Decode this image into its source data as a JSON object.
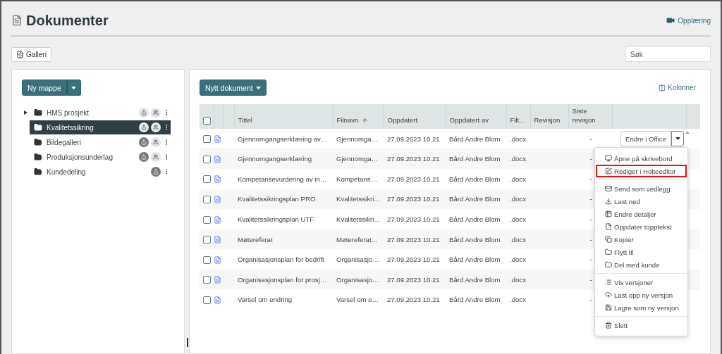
{
  "header": {
    "title": "Dokumenter",
    "training_link": "Opplæring"
  },
  "toolbar": {
    "gallery_button": "Galleri",
    "search": {
      "placeholder": "Søk"
    }
  },
  "folders": {
    "new_button": "Ny mappe",
    "items": [
      {
        "label": "HMS prosjekt",
        "kind": "closed",
        "expandable": true,
        "selected": false,
        "shared": false,
        "people": true
      },
      {
        "label": "Kvalitetssikring",
        "kind": "closed",
        "expandable": false,
        "selected": true,
        "shared": false,
        "people": true
      },
      {
        "label": "Bildegalleri",
        "kind": "open",
        "expandable": false,
        "selected": false,
        "shared": true,
        "people": true
      },
      {
        "label": "Produksjonsunderlag",
        "kind": "open",
        "expandable": false,
        "selected": false,
        "shared": true,
        "people": true
      },
      {
        "label": "Kundedeling",
        "kind": "open",
        "expandable": false,
        "selected": false,
        "shared": true,
        "people": false
      }
    ]
  },
  "documents": {
    "new_button": "Nytt dokument",
    "columns_button": "Kolonner",
    "select_all": {
      "checked": false
    },
    "columns": [
      {
        "label": "Tittel",
        "sorted": false
      },
      {
        "label": "Filnavn",
        "sorted": true
      },
      {
        "label": "Oppdatert",
        "sorted": false
      },
      {
        "label": "Oppdatert av",
        "sorted": false
      },
      {
        "label": "Filt…",
        "sorted": false
      },
      {
        "label": "Revisjon",
        "sorted": false
      },
      {
        "label": "Siste revisjon",
        "sorted": false
      }
    ],
    "rows": [
      {
        "title": "Gjennomgangserklæring av…",
        "filename": "Gjennomga…",
        "updated": "27.09.2023 10.21",
        "updated_by": "Bård Andre Blom",
        "filetype": ".docx",
        "last_revision": "-",
        "action": "Endre i Office",
        "checked": false
      },
      {
        "title": "Gjennomgangserklæring",
        "filename": "Gjennomga…",
        "updated": "27.09.2023 10.21",
        "updated_by": "Bård Andre Blom",
        "filetype": ".docx",
        "last_revision": "-",
        "checked": false
      },
      {
        "title": "Kompetansevurdering av in…",
        "filename": "Kompetans…",
        "updated": "27.09.2023 10.21",
        "updated_by": "Bård Andre Blom",
        "filetype": ".docx",
        "last_revision": "-",
        "checked": false
      },
      {
        "title": "Kvalitetssikringsplan PRO",
        "filename": "Kvalitetssikri…",
        "updated": "27.09.2023 10.21",
        "updated_by": "Bård Andre Blom",
        "filetype": ".docx",
        "last_revision": "-",
        "checked": false
      },
      {
        "title": "Kvalitetssikringsplan UTF",
        "filename": "Kvalitetssikri…",
        "updated": "27.09.2023 10.21",
        "updated_by": "Bård Andre Blom",
        "filetype": ".docx",
        "last_revision": "-",
        "checked": false
      },
      {
        "title": "Møtereferat",
        "filename": "Møtereferat…",
        "updated": "27.09.2023 10.21",
        "updated_by": "Bård Andre Blom",
        "filetype": ".docx",
        "last_revision": "-",
        "checked": false
      },
      {
        "title": "Organisasjonsplan for bedrift",
        "filename": "Organisasjo…",
        "updated": "27.09.2023 10.21",
        "updated_by": "Bård Andre Blom",
        "filetype": ".docx",
        "last_revision": "-",
        "checked": false
      },
      {
        "title": "Organisasjonsplan for prosj…",
        "filename": "Organisasjo…",
        "updated": "27.09.2023 10.21",
        "updated_by": "Bård Andre Blom",
        "filetype": ".docx",
        "last_revision": "-",
        "checked": false
      },
      {
        "title": "Varsel om endring",
        "filename": "Varsel om e…",
        "updated": "27.09.2023 10.21",
        "updated_by": "Bård Andre Blom",
        "filetype": ".docx",
        "last_revision": "-",
        "checked": false
      }
    ],
    "menu": [
      [
        {
          "label": "Åpne på skrivebord",
          "highlighted": false
        },
        {
          "label": "Rediger i Holteeditor",
          "highlighted": true
        }
      ],
      [
        {
          "label": "Send som vedlegg",
          "highlighted": false
        },
        {
          "label": "Last ned",
          "highlighted": false
        },
        {
          "label": "Endre detaljer",
          "highlighted": false
        },
        {
          "label": "Oppdater topptekst",
          "highlighted": false
        },
        {
          "label": "Kopier",
          "highlighted": false
        },
        {
          "label": "Flytt til",
          "highlighted": false
        },
        {
          "label": "Del med kunde",
          "highlighted": false
        }
      ],
      [
        {
          "label": "Vis versjoner",
          "highlighted": false
        },
        {
          "label": "Last opp ny versjon",
          "highlighted": false
        },
        {
          "label": "Lagre som ny versjon",
          "highlighted": false
        }
      ],
      [
        {
          "label": "Slett",
          "highlighted": false
        }
      ]
    ]
  }
}
